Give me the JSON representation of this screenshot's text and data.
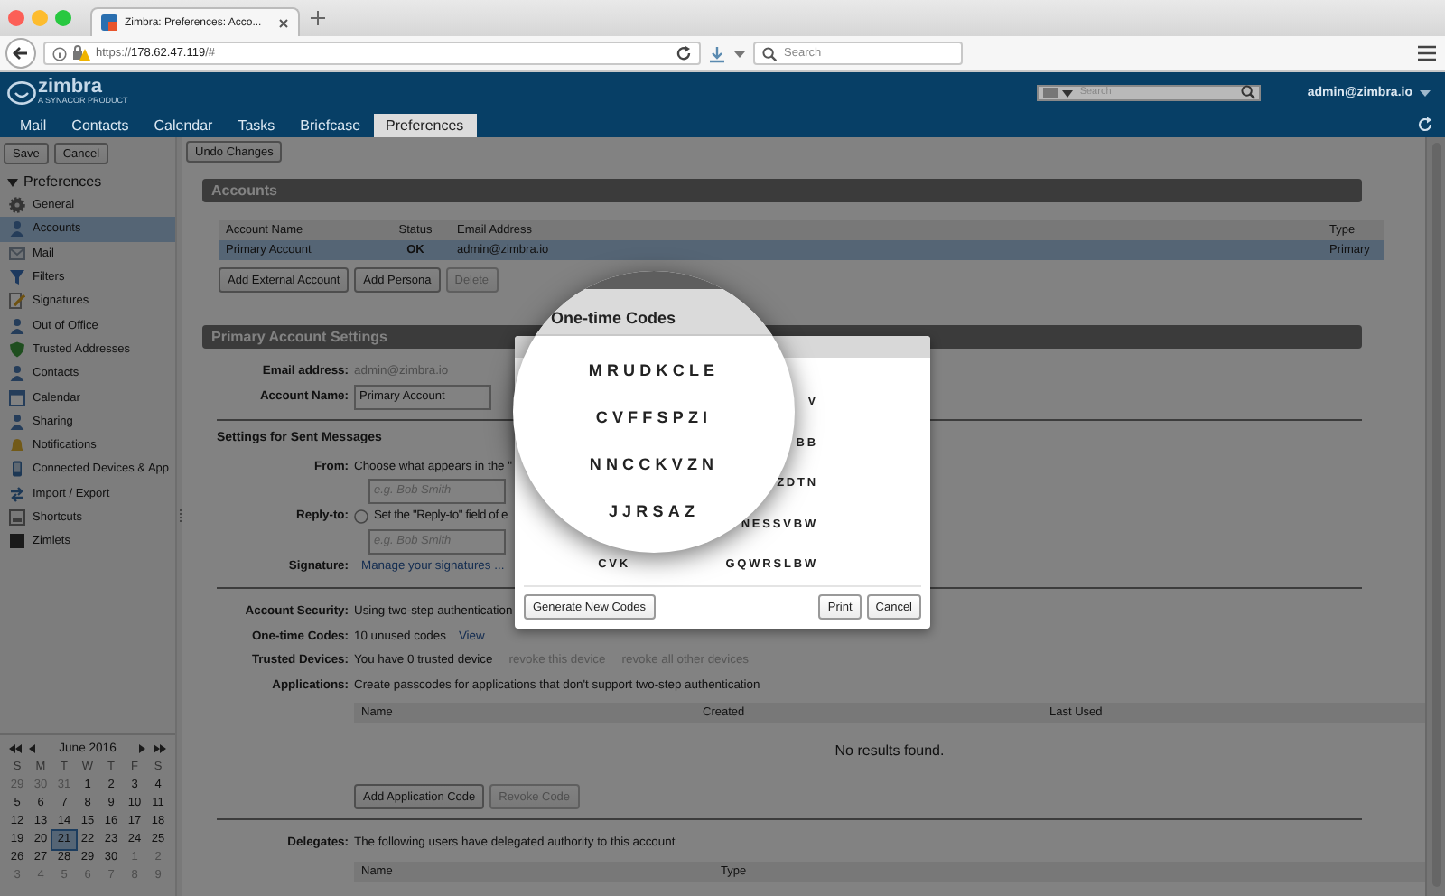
{
  "browser": {
    "tab_title": "Zimbra: Preferences: Acco...",
    "url_scheme": "https://",
    "url_host": "178.62.47.119",
    "url_path": "/#",
    "search_placeholder": "Search"
  },
  "app": {
    "logo": "zimbra",
    "logo_tagline": "A SYNACOR PRODUCT",
    "search_placeholder": "Search",
    "user": "admin@zimbra.io"
  },
  "tabs": [
    {
      "label": "Mail",
      "selected": false
    },
    {
      "label": "Contacts",
      "selected": false
    },
    {
      "label": "Calendar",
      "selected": false
    },
    {
      "label": "Tasks",
      "selected": false
    },
    {
      "label": "Briefcase",
      "selected": false
    },
    {
      "label": "Preferences",
      "selected": true
    }
  ],
  "sidebar": {
    "buttons": [
      "Save",
      "Cancel"
    ],
    "heading": "Preferences",
    "expanded": true,
    "items": [
      {
        "label": "General",
        "selected": false
      },
      {
        "label": "Accounts",
        "selected": true
      },
      {
        "label": "Mail",
        "selected": false
      },
      {
        "label": "Filters",
        "selected": false
      },
      {
        "label": "Signatures",
        "selected": false
      },
      {
        "label": "Out of Office",
        "selected": false
      },
      {
        "label": "Trusted Addresses",
        "selected": false
      },
      {
        "label": "Contacts",
        "selected": false
      },
      {
        "label": "Calendar",
        "selected": false
      },
      {
        "label": "Sharing",
        "selected": false
      },
      {
        "label": "Notifications",
        "selected": false
      },
      {
        "label": "Connected Devices & App",
        "selected": false
      },
      {
        "label": "Import / Export",
        "selected": false
      },
      {
        "label": "Shortcuts",
        "selected": false
      },
      {
        "label": "Zimlets",
        "selected": false
      }
    ]
  },
  "calendar": {
    "month": "June 2016",
    "weekdays": [
      "S",
      "M",
      "T",
      "W",
      "T",
      "F",
      "S"
    ],
    "weeks": [
      [
        {
          "day": "29",
          "other_month": true,
          "selected": false
        },
        {
          "day": "30",
          "other_month": true,
          "selected": false
        },
        {
          "day": "31",
          "other_month": true,
          "selected": false
        },
        {
          "day": "1",
          "other_month": false,
          "selected": false
        },
        {
          "day": "2",
          "other_month": false,
          "selected": false
        },
        {
          "day": "3",
          "other_month": false,
          "selected": false
        },
        {
          "day": "4",
          "other_month": false,
          "selected": false
        }
      ],
      [
        {
          "day": "5",
          "other_month": false,
          "selected": false
        },
        {
          "day": "6",
          "other_month": false,
          "selected": false
        },
        {
          "day": "7",
          "other_month": false,
          "selected": false
        },
        {
          "day": "8",
          "other_month": false,
          "selected": false
        },
        {
          "day": "9",
          "other_month": false,
          "selected": false
        },
        {
          "day": "10",
          "other_month": false,
          "selected": false
        },
        {
          "day": "11",
          "other_month": false,
          "selected": false
        }
      ],
      [
        {
          "day": "12",
          "other_month": false,
          "selected": false
        },
        {
          "day": "13",
          "other_month": false,
          "selected": false
        },
        {
          "day": "14",
          "other_month": false,
          "selected": false
        },
        {
          "day": "15",
          "other_month": false,
          "selected": false
        },
        {
          "day": "16",
          "other_month": false,
          "selected": false
        },
        {
          "day": "17",
          "other_month": false,
          "selected": false
        },
        {
          "day": "18",
          "other_month": false,
          "selected": false
        }
      ],
      [
        {
          "day": "19",
          "other_month": false,
          "selected": false
        },
        {
          "day": "20",
          "other_month": false,
          "selected": false
        },
        {
          "day": "21",
          "other_month": false,
          "selected": true
        },
        {
          "day": "22",
          "other_month": false,
          "selected": false
        },
        {
          "day": "23",
          "other_month": false,
          "selected": false
        },
        {
          "day": "24",
          "other_month": false,
          "selected": false
        },
        {
          "day": "25",
          "other_month": false,
          "selected": false
        }
      ],
      [
        {
          "day": "26",
          "other_month": false,
          "selected": false
        },
        {
          "day": "27",
          "other_month": false,
          "selected": false
        },
        {
          "day": "28",
          "other_month": false,
          "selected": false
        },
        {
          "day": "29",
          "other_month": false,
          "selected": false
        },
        {
          "day": "30",
          "other_month": false,
          "selected": false
        },
        {
          "day": "1",
          "other_month": true,
          "selected": false
        },
        {
          "day": "2",
          "other_month": true,
          "selected": false
        }
      ],
      [
        {
          "day": "3",
          "other_month": true,
          "selected": false
        },
        {
          "day": "4",
          "other_month": true,
          "selected": false
        },
        {
          "day": "5",
          "other_month": true,
          "selected": false
        },
        {
          "day": "6",
          "other_month": true,
          "selected": false
        },
        {
          "day": "7",
          "other_month": true,
          "selected": false
        },
        {
          "day": "8",
          "other_month": true,
          "selected": false
        },
        {
          "day": "9",
          "other_month": true,
          "selected": false
        }
      ]
    ]
  },
  "main": {
    "toolbar_button": "Undo Changes",
    "accounts": {
      "title": "Accounts",
      "columns": [
        "Account Name",
        "Status",
        "Email Address",
        "Type"
      ],
      "rows": [
        {
          "cells": [
            "Primary Account",
            "OK",
            "admin@zimbra.io",
            "Primary"
          ],
          "selected": true
        }
      ],
      "buttons": [
        {
          "label": "Add External Account",
          "disabled": false
        },
        {
          "label": "Add Persona",
          "disabled": false
        },
        {
          "label": "Delete",
          "disabled": true
        }
      ]
    },
    "settings": {
      "title": "Primary Account Settings",
      "email_label": "Email address:",
      "email_value": "admin@zimbra.io",
      "name_label": "Account Name:",
      "name_value": "Primary Account",
      "sent_heading": "Settings for Sent Messages",
      "from_label": "From:",
      "from_text": "Choose what appears in the \"",
      "from_placeholder": "e.g. Bob Smith",
      "replyto_label": "Reply-to:",
      "replyto_checked": false,
      "replyto_text": "Set the \"Reply-to\" field of e",
      "replyto_placeholder": "e.g. Bob Smith",
      "signature_label": "Signature:",
      "signature_link": "Manage your signatures ..."
    },
    "security": [
      {
        "label": "Account Security:",
        "parts": [
          {
            "kind": "text",
            "text": "Using two-step authentication"
          }
        ]
      },
      {
        "label": "One-time Codes:",
        "parts": [
          {
            "kind": "text",
            "text": "10 unused codes"
          },
          {
            "kind": "link",
            "text": "View"
          }
        ]
      },
      {
        "label": "Trusted Devices:",
        "parts": [
          {
            "kind": "text",
            "text": "You have 0 trusted device"
          },
          {
            "kind": "disabled_link",
            "text": "revoke this device"
          },
          {
            "kind": "disabled_link",
            "text": "revoke all other devices"
          }
        ]
      },
      {
        "label": "Applications:",
        "parts": [
          {
            "kind": "text",
            "text": "Create passcodes for applications that don't support two-step authentication"
          }
        ]
      }
    ],
    "applications": {
      "columns": [
        "Name",
        "Created",
        "Last Used"
      ],
      "empty_text": "No results found.",
      "buttons": [
        {
          "label": "Add Application Code",
          "disabled": false
        },
        {
          "label": "Revoke Code",
          "disabled": true
        }
      ]
    },
    "delegates": {
      "label": "Delegates:",
      "text": "The following users have delegated authority to this account",
      "columns": [
        "Name",
        "Type"
      ]
    }
  },
  "dialog": {
    "left_codes": [
      "CVK"
    ],
    "right_codes": [
      "V",
      "BB",
      "ZDTN",
      "NESSVBW",
      "GQWRSLBW"
    ],
    "buttons": [
      "Generate New Codes",
      "Print",
      "Cancel"
    ]
  },
  "magnifier": {
    "title": "One-time Codes",
    "codes": [
      "MRUDKCLE",
      "CVFFSPZI",
      "NNCCKVZN",
      "JJRSAZ"
    ]
  }
}
